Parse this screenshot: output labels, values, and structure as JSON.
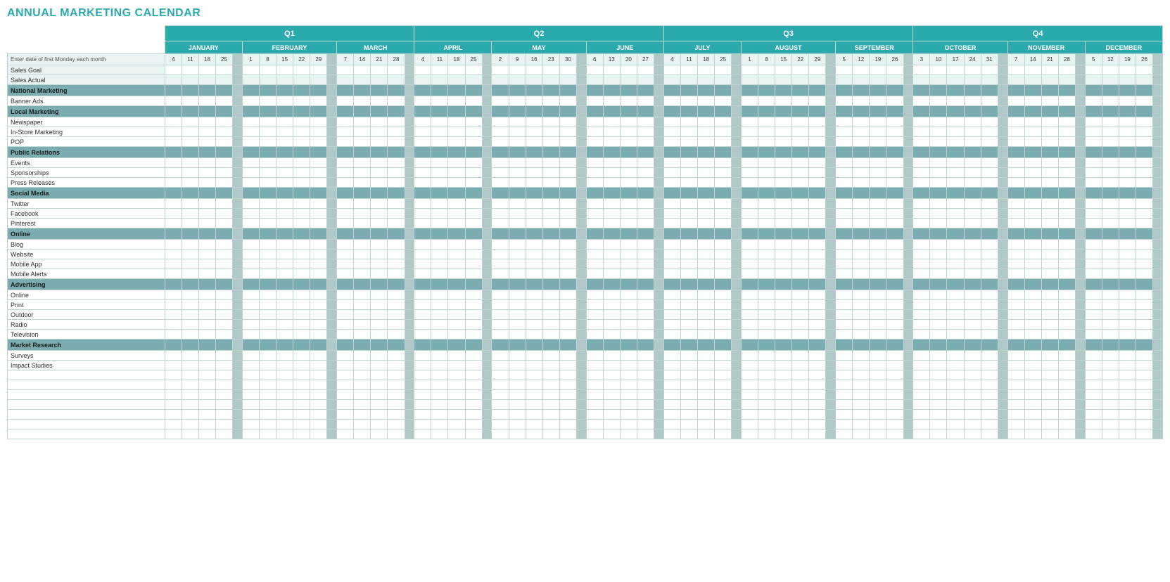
{
  "title": "ANNUAL MARKETING CALENDAR",
  "quarters": [
    {
      "label": "Q1",
      "colspan": 17
    },
    {
      "label": "Q2",
      "colspan": 17
    },
    {
      "label": "Q3",
      "colspan": 17
    },
    {
      "label": "Q4",
      "colspan": 17
    }
  ],
  "months": [
    {
      "label": "JANUARY",
      "days": [
        "4",
        "11",
        "18",
        "25"
      ],
      "sep": "-"
    },
    {
      "label": "FEBRUARY",
      "days": [
        "1",
        "8",
        "15",
        "22",
        "29"
      ],
      "sep": "-"
    },
    {
      "label": "MARCH",
      "days": [
        "7",
        "14",
        "21",
        "28"
      ],
      "sep": "-"
    },
    {
      "label": "APRIL",
      "days": [
        "4",
        "11",
        "18",
        "25"
      ],
      "sep": "-"
    },
    {
      "label": "MAY",
      "days": [
        "2",
        "9",
        "16",
        "23",
        "30"
      ],
      "sep": "-"
    },
    {
      "label": "JUNE",
      "days": [
        "6",
        "13",
        "20",
        "27"
      ],
      "sep": "-"
    },
    {
      "label": "JULY",
      "days": [
        "4",
        "11",
        "18",
        "25"
      ],
      "sep": "-"
    },
    {
      "label": "AUGUST",
      "days": [
        "1",
        "8",
        "15",
        "22",
        "29"
      ],
      "sep": "-"
    },
    {
      "label": "SEPTEMBER",
      "days": [
        "5",
        "12",
        "19",
        "26"
      ],
      "sep": "-"
    },
    {
      "label": "OCTOBER",
      "days": [
        "3",
        "10",
        "17",
        "24",
        "31"
      ],
      "sep": "-"
    },
    {
      "label": "NOVEMBER",
      "days": [
        "7",
        "14",
        "21",
        "28"
      ],
      "sep": "-"
    },
    {
      "label": "DECEMBER",
      "days": [
        "5",
        "12",
        "19",
        "26"
      ],
      "sep": "-"
    }
  ],
  "instruction_label": "Enter date of first Monday each month",
  "rows": [
    {
      "type": "sales",
      "label": "Sales Goal"
    },
    {
      "type": "sales",
      "label": "Sales Actual"
    },
    {
      "type": "category",
      "label": "National Marketing"
    },
    {
      "type": "data",
      "label": "Banner Ads"
    },
    {
      "type": "category",
      "label": "Local Marketing"
    },
    {
      "type": "data",
      "label": "Newspaper"
    },
    {
      "type": "data",
      "label": "In-Store Marketing"
    },
    {
      "type": "data",
      "label": "POP"
    },
    {
      "type": "category",
      "label": "Public Relations"
    },
    {
      "type": "data",
      "label": "Events"
    },
    {
      "type": "data",
      "label": "Sponsorships"
    },
    {
      "type": "data",
      "label": "Press Releases"
    },
    {
      "type": "category",
      "label": "Social Media"
    },
    {
      "type": "data",
      "label": "Twitter"
    },
    {
      "type": "data",
      "label": "Facebook"
    },
    {
      "type": "data",
      "label": "Pinterest"
    },
    {
      "type": "category",
      "label": "Online"
    },
    {
      "type": "data",
      "label": "Blog"
    },
    {
      "type": "data",
      "label": "Website"
    },
    {
      "type": "data",
      "label": "Mobile App"
    },
    {
      "type": "data",
      "label": "Mobile Alerts"
    },
    {
      "type": "category",
      "label": "Advertising"
    },
    {
      "type": "data",
      "label": "Online"
    },
    {
      "type": "data",
      "label": "Print"
    },
    {
      "type": "data",
      "label": "Outdoor"
    },
    {
      "type": "data",
      "label": "Radio"
    },
    {
      "type": "data",
      "label": "Television"
    },
    {
      "type": "category",
      "label": "Market Research"
    },
    {
      "type": "data",
      "label": "Surveys"
    },
    {
      "type": "data",
      "label": "Impact Studies"
    },
    {
      "type": "empty",
      "label": ""
    },
    {
      "type": "empty",
      "label": ""
    },
    {
      "type": "empty",
      "label": ""
    },
    {
      "type": "empty",
      "label": ""
    },
    {
      "type": "empty",
      "label": ""
    },
    {
      "type": "empty",
      "label": ""
    },
    {
      "type": "empty",
      "label": ""
    }
  ]
}
